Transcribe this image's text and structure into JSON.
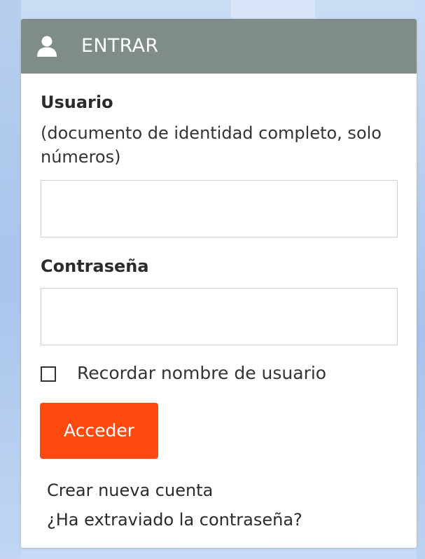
{
  "login": {
    "header_title": "ENTRAR",
    "header_icon": "user-icon",
    "username_label": "Usuario",
    "username_help": "(documento de identidad completo, solo números)",
    "username_value": "",
    "password_label": "Contraseña",
    "password_value": "",
    "remember_checked": false,
    "remember_label": "Recordar nombre de usuario",
    "submit_label": "Acceder",
    "create_account_link": "Crear nueva cuenta",
    "forgot_password_link": "¿Ha extraviado la contraseña?"
  },
  "colors": {
    "header_bg": "#7f8c8a",
    "button_bg": "#ff4a0f",
    "page_bg": "#c6dbf5"
  }
}
